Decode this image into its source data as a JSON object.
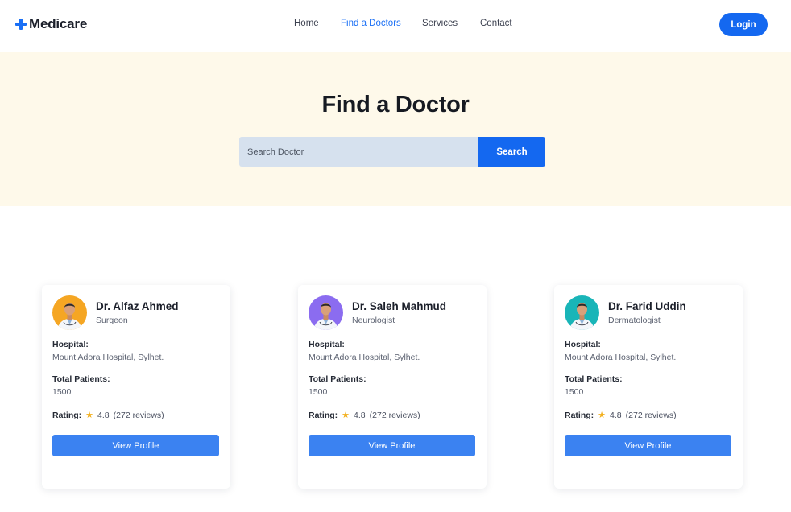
{
  "brand": {
    "name": "Medicare",
    "accent": "#1468f0",
    "icon": "plus-icon"
  },
  "nav": {
    "links": [
      {
        "label": "Home",
        "active": false
      },
      {
        "label": "Find a Doctors",
        "active": true
      },
      {
        "label": "Services",
        "active": false
      },
      {
        "label": "Contact",
        "active": false
      }
    ],
    "login_label": "Login"
  },
  "hero": {
    "title": "Find a Doctor",
    "search_placeholder": "Search Doctor",
    "search_button": "Search",
    "background": "#fef9ea"
  },
  "doctors": [
    {
      "name": "Dr. Alfaz Ahmed",
      "specialty": "Surgeon",
      "hospital_label": "Hospital:",
      "hospital": "Mount Adora Hospital, Sylhet.",
      "patients_label": "Total Patients:",
      "patients": "1500",
      "rating_label": "Rating:",
      "rating": "4.8",
      "reviews": "(272 reviews)",
      "button": "View Profile",
      "avatar_bg": "#f5a623"
    },
    {
      "name": "Dr. Saleh Mahmud",
      "specialty": "Neurologist",
      "hospital_label": "Hospital:",
      "hospital": "Mount Adora Hospital, Sylhet.",
      "patients_label": "Total Patients:",
      "patients": "1500",
      "rating_label": "Rating:",
      "rating": "4.8",
      "reviews": "(272 reviews)",
      "button": "View Profile",
      "avatar_bg": "#8b6cf0"
    },
    {
      "name": "Dr. Farid Uddin",
      "specialty": "Dermatologist",
      "hospital_label": "Hospital:",
      "hospital": "Mount Adora Hospital, Sylhet.",
      "patients_label": "Total Patients:",
      "patients": "1500",
      "rating_label": "Rating:",
      "rating": "4.8",
      "reviews": "(272 reviews)",
      "button": "View Profile",
      "avatar_bg": "#19b5b8"
    }
  ]
}
